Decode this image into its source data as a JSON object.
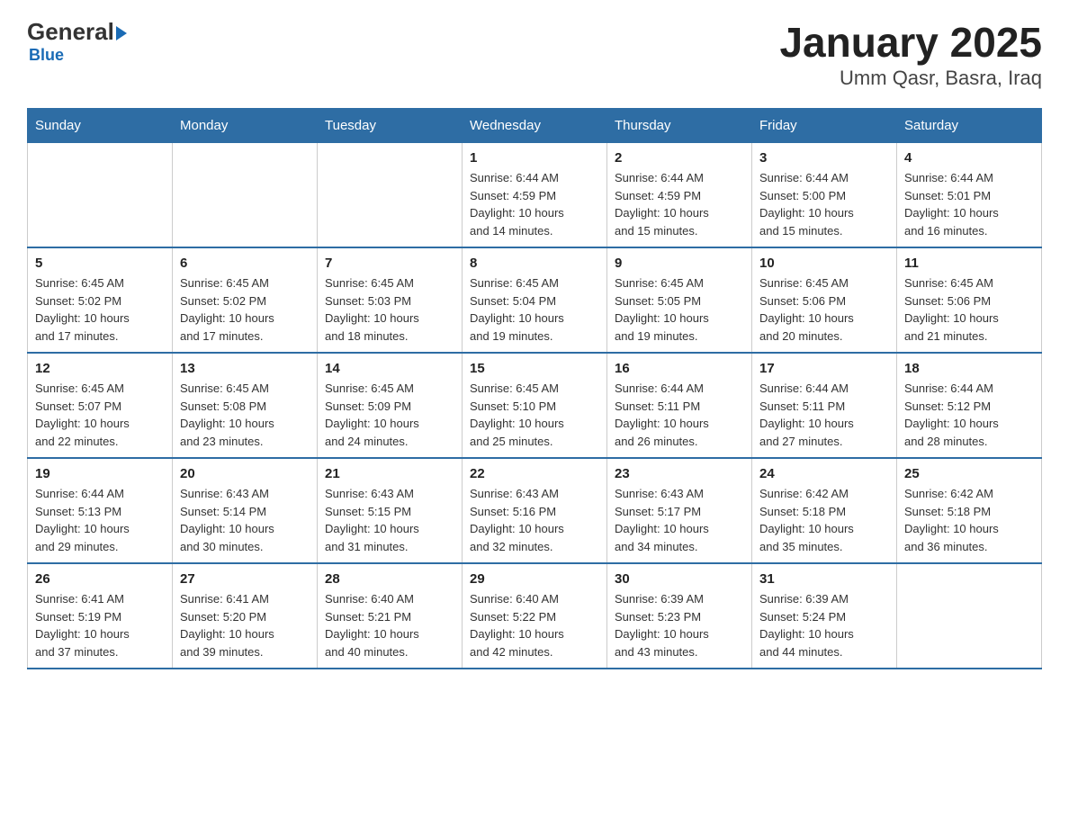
{
  "header": {
    "logo": {
      "general": "General",
      "blue": "Blue",
      "arrow": true
    },
    "title": "January 2025",
    "subtitle": "Umm Qasr, Basra, Iraq"
  },
  "days_of_week": [
    "Sunday",
    "Monday",
    "Tuesday",
    "Wednesday",
    "Thursday",
    "Friday",
    "Saturday"
  ],
  "weeks": [
    [
      {
        "day": "",
        "info": ""
      },
      {
        "day": "",
        "info": ""
      },
      {
        "day": "",
        "info": ""
      },
      {
        "day": "1",
        "info": "Sunrise: 6:44 AM\nSunset: 4:59 PM\nDaylight: 10 hours\nand 14 minutes."
      },
      {
        "day": "2",
        "info": "Sunrise: 6:44 AM\nSunset: 4:59 PM\nDaylight: 10 hours\nand 15 minutes."
      },
      {
        "day": "3",
        "info": "Sunrise: 6:44 AM\nSunset: 5:00 PM\nDaylight: 10 hours\nand 15 minutes."
      },
      {
        "day": "4",
        "info": "Sunrise: 6:44 AM\nSunset: 5:01 PM\nDaylight: 10 hours\nand 16 minutes."
      }
    ],
    [
      {
        "day": "5",
        "info": "Sunrise: 6:45 AM\nSunset: 5:02 PM\nDaylight: 10 hours\nand 17 minutes."
      },
      {
        "day": "6",
        "info": "Sunrise: 6:45 AM\nSunset: 5:02 PM\nDaylight: 10 hours\nand 17 minutes."
      },
      {
        "day": "7",
        "info": "Sunrise: 6:45 AM\nSunset: 5:03 PM\nDaylight: 10 hours\nand 18 minutes."
      },
      {
        "day": "8",
        "info": "Sunrise: 6:45 AM\nSunset: 5:04 PM\nDaylight: 10 hours\nand 19 minutes."
      },
      {
        "day": "9",
        "info": "Sunrise: 6:45 AM\nSunset: 5:05 PM\nDaylight: 10 hours\nand 19 minutes."
      },
      {
        "day": "10",
        "info": "Sunrise: 6:45 AM\nSunset: 5:06 PM\nDaylight: 10 hours\nand 20 minutes."
      },
      {
        "day": "11",
        "info": "Sunrise: 6:45 AM\nSunset: 5:06 PM\nDaylight: 10 hours\nand 21 minutes."
      }
    ],
    [
      {
        "day": "12",
        "info": "Sunrise: 6:45 AM\nSunset: 5:07 PM\nDaylight: 10 hours\nand 22 minutes."
      },
      {
        "day": "13",
        "info": "Sunrise: 6:45 AM\nSunset: 5:08 PM\nDaylight: 10 hours\nand 23 minutes."
      },
      {
        "day": "14",
        "info": "Sunrise: 6:45 AM\nSunset: 5:09 PM\nDaylight: 10 hours\nand 24 minutes."
      },
      {
        "day": "15",
        "info": "Sunrise: 6:45 AM\nSunset: 5:10 PM\nDaylight: 10 hours\nand 25 minutes."
      },
      {
        "day": "16",
        "info": "Sunrise: 6:44 AM\nSunset: 5:11 PM\nDaylight: 10 hours\nand 26 minutes."
      },
      {
        "day": "17",
        "info": "Sunrise: 6:44 AM\nSunset: 5:11 PM\nDaylight: 10 hours\nand 27 minutes."
      },
      {
        "day": "18",
        "info": "Sunrise: 6:44 AM\nSunset: 5:12 PM\nDaylight: 10 hours\nand 28 minutes."
      }
    ],
    [
      {
        "day": "19",
        "info": "Sunrise: 6:44 AM\nSunset: 5:13 PM\nDaylight: 10 hours\nand 29 minutes."
      },
      {
        "day": "20",
        "info": "Sunrise: 6:43 AM\nSunset: 5:14 PM\nDaylight: 10 hours\nand 30 minutes."
      },
      {
        "day": "21",
        "info": "Sunrise: 6:43 AM\nSunset: 5:15 PM\nDaylight: 10 hours\nand 31 minutes."
      },
      {
        "day": "22",
        "info": "Sunrise: 6:43 AM\nSunset: 5:16 PM\nDaylight: 10 hours\nand 32 minutes."
      },
      {
        "day": "23",
        "info": "Sunrise: 6:43 AM\nSunset: 5:17 PM\nDaylight: 10 hours\nand 34 minutes."
      },
      {
        "day": "24",
        "info": "Sunrise: 6:42 AM\nSunset: 5:18 PM\nDaylight: 10 hours\nand 35 minutes."
      },
      {
        "day": "25",
        "info": "Sunrise: 6:42 AM\nSunset: 5:18 PM\nDaylight: 10 hours\nand 36 minutes."
      }
    ],
    [
      {
        "day": "26",
        "info": "Sunrise: 6:41 AM\nSunset: 5:19 PM\nDaylight: 10 hours\nand 37 minutes."
      },
      {
        "day": "27",
        "info": "Sunrise: 6:41 AM\nSunset: 5:20 PM\nDaylight: 10 hours\nand 39 minutes."
      },
      {
        "day": "28",
        "info": "Sunrise: 6:40 AM\nSunset: 5:21 PM\nDaylight: 10 hours\nand 40 minutes."
      },
      {
        "day": "29",
        "info": "Sunrise: 6:40 AM\nSunset: 5:22 PM\nDaylight: 10 hours\nand 42 minutes."
      },
      {
        "day": "30",
        "info": "Sunrise: 6:39 AM\nSunset: 5:23 PM\nDaylight: 10 hours\nand 43 minutes."
      },
      {
        "day": "31",
        "info": "Sunrise: 6:39 AM\nSunset: 5:24 PM\nDaylight: 10 hours\nand 44 minutes."
      },
      {
        "day": "",
        "info": ""
      }
    ]
  ]
}
